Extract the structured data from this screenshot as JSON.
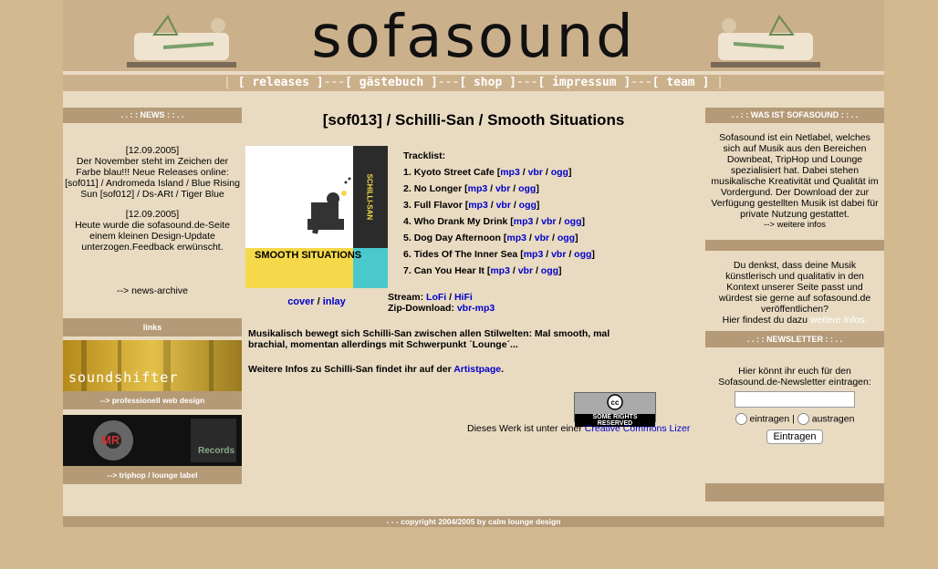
{
  "header": {
    "logo": "sofasound"
  },
  "nav": {
    "items": [
      "[ releases ]",
      "[ gästebuch ]",
      "[ shop ]",
      "[ impressum ]",
      "[ team ]"
    ],
    "sep": "---"
  },
  "left": {
    "news_title": ". . : : NEWS : : . .",
    "news1_date": "[12.09.2005]",
    "news1_text": "Der November steht im Zeichen der Farbe blau!!! Neue Releases online: [sof011] / Andromeda Island / Blue Rising Sun [sof012] / Ds-ARt / Tiger Blue",
    "news2_date": "[12.09.2005]",
    "news2_text": "Heute wurde die sofasound.de-Seite einem kleinen Design-Update unterzogen.Feedback erwünscht.",
    "archive": "--> news-archive",
    "links_title": "links",
    "banner1_text": "soundshifter",
    "banner1_caption": "--> professionell web design",
    "banner2_text_a": "MR",
    "banner2_text_b": "Records",
    "banner2_caption": "--> triphop / lounge label"
  },
  "center": {
    "title": "[sof013] / Schilli-San / Smooth Situations",
    "cover_label": "SMOOTH SITUATIONS",
    "cover_artist": "SCHILLI-SAN",
    "cover_link": "cover",
    "inlay_link": "inlay",
    "tracklist_title": "Tracklist:",
    "tracks": [
      {
        "n": "1.",
        "title": "Kyoto Street Cafe"
      },
      {
        "n": "2.",
        "title": "No Longer"
      },
      {
        "n": "3.",
        "title": "Full Flavor"
      },
      {
        "n": "4.",
        "title": "Who Drank My Drink"
      },
      {
        "n": "5.",
        "title": "Dog Day Afternoon"
      },
      {
        "n": "6.",
        "title": "Tides Of The Inner Sea"
      },
      {
        "n": "7.",
        "title": "Can You Hear It"
      }
    ],
    "formats": [
      "mp3",
      "vbr",
      "ogg"
    ],
    "stream_label": "Stream:",
    "stream_lofi": "LoFi",
    "stream_hifi": "HiFi",
    "zip_label": "Zip-Download:",
    "zip_link": "vbr-mp3",
    "desc": "Musikalisch bewegt sich Schilli-San zwischen allen Stilwelten: Mal smooth, mal brachial, momentan allerdings mit Schwerpunkt ´Lounge´...",
    "more_pre": "Weitere Infos zu Schilli-San findet ihr auf der",
    "more_link": "Artistpage",
    "cc_badge": "SOME RIGHTS RESERVED",
    "license_pre": "Dieses Werk ist unter einer",
    "license_link": "Creative Commons Lizer"
  },
  "right": {
    "about_title": ". . : : WAS IST SOFASOUND : : . .",
    "about_text": "Sofasound ist ein Netlabel, welches sich auf Musik aus den Bereichen Downbeat, TripHop und Lounge spezialisiert hat. Dabei stehen musikalische Kreativität und Qualität im Vordergund. Der Download der zur Verfügung gestellten Musik ist dabei für private Nutzung gestattet.",
    "about_link": "--> weitere infos",
    "submit_text": "Du denkst, dass deine Musik künstlerisch und qualitativ in den Kontext unserer Seite passt und würdest sie gerne auf sofasound.de veröffentlichen?",
    "submit_pre": "Hier findest du dazu",
    "submit_link": "weitere Infos.",
    "newsletter_title": ". . : : NEWSLETTER : : . .",
    "newsletter_text": "Hier könnt ihr euch für den Sofasound.de-Newsletter eintragen:",
    "email_value": "",
    "radio_in": "eintragen",
    "radio_sep": "|",
    "radio_out": "austragen",
    "submit_button": "Eintragen"
  },
  "footer": {
    "text": "- - - copyright 2004/2005 by calm lounge design"
  },
  "colors": {
    "bg": "#d2b990",
    "panel": "#e9dbc2",
    "bar": "#b59a77",
    "link": "#0000cc",
    "accent_yellow": "#f5d94b",
    "accent_cyan": "#4ac8cc"
  }
}
